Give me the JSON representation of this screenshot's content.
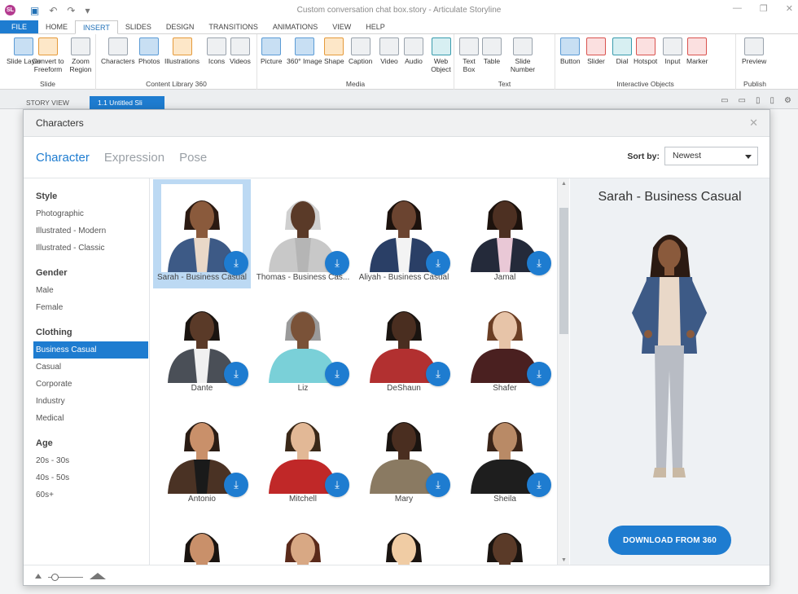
{
  "window": {
    "title": "Custom conversation chat box.story - Articulate Storyline",
    "app_logo": "SL"
  },
  "ribbon_tabs": [
    "FILE",
    "HOME",
    "INSERT",
    "SLIDES",
    "DESIGN",
    "TRANSITIONS",
    "ANIMATIONS",
    "VIEW",
    "HELP"
  ],
  "ribbon": {
    "slide_group": {
      "label": "Slide",
      "buttons": [
        "Slide Layer",
        "Convert to Freeform",
        "Zoom Region"
      ]
    },
    "content_group": {
      "label": "Content Library 360",
      "buttons": [
        "Characters",
        "Photos",
        "Illustrations",
        "Icons",
        "Videos"
      ]
    },
    "media_group": {
      "label": "Media",
      "buttons": [
        "Picture",
        "360° Image",
        "Shape",
        "Caption",
        "Video",
        "Audio",
        "Web Object"
      ]
    },
    "text_group": {
      "label": "Text",
      "buttons": [
        "Text Box",
        "Table",
        "Slide Number"
      ]
    },
    "interactive_group": {
      "label": "Interactive Objects",
      "buttons": [
        "Button",
        "Slider",
        "Dial",
        "Hotspot",
        "Input",
        "Marker"
      ]
    },
    "publish_group": {
      "label": "Publish",
      "buttons": [
        "Preview"
      ]
    }
  },
  "view_tabs": {
    "story": "STORY VIEW",
    "slide": "1.1 Untitled Sli"
  },
  "dialog": {
    "title": "Characters",
    "subtabs": [
      "Character",
      "Expression",
      "Pose"
    ],
    "sort_label": "Sort by:",
    "sort_value": "Newest",
    "filters": [
      {
        "heading": "Style",
        "items": [
          "Photographic",
          "Illustrated - Modern",
          "Illustrated - Classic"
        ]
      },
      {
        "heading": "Gender",
        "items": [
          "Male",
          "Female"
        ]
      },
      {
        "heading": "Clothing",
        "items": [
          "Business Casual",
          "Casual",
          "Corporate",
          "Industry",
          "Medical"
        ]
      },
      {
        "heading": "Age",
        "items": [
          "20s - 30s",
          "40s - 50s",
          "60s+"
        ]
      }
    ],
    "selected_filter": "Business Casual",
    "characters": [
      {
        "name": "Sarah - Business Casual",
        "skin": "#8a5a3c",
        "hair": "#2b1a12",
        "shirt": "#3d5a86",
        "inner": "#e9d8c8"
      },
      {
        "name": "Thomas - Business Cas...",
        "skin": "#5a3a28",
        "hair": "#cfcfcf",
        "shirt": "#c8c8c8",
        "inner": "#b5b5b5"
      },
      {
        "name": "Aliyah - Business Casual",
        "skin": "#6b4430",
        "hair": "#1c120d",
        "shirt": "#2a3f66",
        "inner": "#f3f3f3"
      },
      {
        "name": "Jamal",
        "skin": "#4d3022",
        "hair": "#1c120d",
        "shirt": "#242a3a",
        "inner": "#e9c8d6"
      },
      {
        "name": "Dante",
        "skin": "#5a3a28",
        "hair": "#1a1410",
        "shirt": "#4a4f57",
        "inner": "#f0f0f0"
      },
      {
        "name": "Liz",
        "skin": "#7a5238",
        "hair": "#9a9a9a",
        "shirt": "#7ad0d8",
        "inner": "#7ad0d8"
      },
      {
        "name": "DeShaun",
        "skin": "#4a2e20",
        "hair": "#1a1410",
        "shirt": "#b23030",
        "inner": "#b23030"
      },
      {
        "name": "Shafer",
        "skin": "#e7c4a8",
        "hair": "#6b3e24",
        "shirt": "#4a2020",
        "inner": "#4a2020"
      },
      {
        "name": "Antonio",
        "skin": "#c9906a",
        "hair": "#2a1c14",
        "shirt": "#4a3224",
        "inner": "#1a1a1a"
      },
      {
        "name": "Mitchell",
        "skin": "#e2b896",
        "hair": "#3a2818",
        "shirt": "#c02828",
        "inner": "#c02828"
      },
      {
        "name": "Mary",
        "skin": "#4a2e20",
        "hair": "#1a1410",
        "shirt": "#8a7a62",
        "inner": "#8a7a62"
      },
      {
        "name": "Sheila",
        "skin": "#b98a66",
        "hair": "#3a2418",
        "shirt": "#1e1e1e",
        "inner": "#1e1e1e"
      },
      {
        "name": "",
        "skin": "#c9906a",
        "hair": "#1a1410",
        "shirt": "#4a5260",
        "inner": "#4a5260"
      },
      {
        "name": "",
        "skin": "#d8a884",
        "hair": "#5a2a1a",
        "shirt": "#e8e8e8",
        "inner": "#e8e8e8"
      },
      {
        "name": "",
        "skin": "#f0cca4",
        "hair": "#1a1410",
        "shirt": "#f0f0f0",
        "inner": "#f0f0f0"
      },
      {
        "name": "",
        "skin": "#5a3a28",
        "hair": "#1a1410",
        "shirt": "#1e1e1e",
        "inner": "#1e1e1e"
      }
    ],
    "preview_title": "Sarah - Business Casual",
    "download_label": "DOWNLOAD FROM 360"
  },
  "colors": {
    "accent": "#1e7cd0",
    "selected_card": "#bcd9f3"
  }
}
